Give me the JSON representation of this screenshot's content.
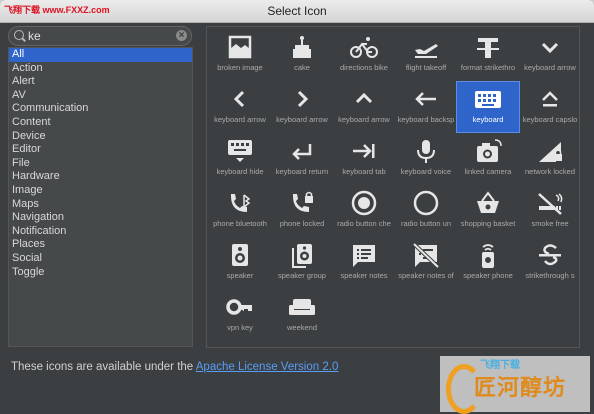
{
  "window": {
    "title": "Select Icon"
  },
  "watermark_top": "飞翔下载 www.FXXZ.com",
  "search": {
    "value": "ke"
  },
  "categories": [
    "All",
    "Action",
    "Alert",
    "AV",
    "Communication",
    "Content",
    "Device",
    "Editor",
    "File",
    "Hardware",
    "Image",
    "Maps",
    "Navigation",
    "Notification",
    "Places",
    "Social",
    "Toggle"
  ],
  "selected_category": "All",
  "icons": [
    {
      "label": "broken image",
      "icon": "broken-image-icon"
    },
    {
      "label": "cake",
      "icon": "cake-icon"
    },
    {
      "label": "directions bike",
      "icon": "bike-icon"
    },
    {
      "label": "flight takeoff",
      "icon": "flight-takeoff-icon"
    },
    {
      "label": "format strikethro",
      "icon": "strikethrough-icon"
    },
    {
      "label": "keyboard arrow",
      "icon": "arrow-down-icon"
    },
    {
      "label": "keyboard arrow",
      "icon": "arrow-left-icon"
    },
    {
      "label": "keyboard arrow",
      "icon": "arrow-right-icon"
    },
    {
      "label": "keyboard arrow",
      "icon": "arrow-up-icon"
    },
    {
      "label": "keyboard backsp",
      "icon": "backspace-icon"
    },
    {
      "label": "keyboard",
      "icon": "keyboard-icon"
    },
    {
      "label": "keyboard capslo",
      "icon": "capslock-icon"
    },
    {
      "label": "keyboard hide",
      "icon": "keyboard-hide-icon"
    },
    {
      "label": "keyboard return",
      "icon": "return-icon"
    },
    {
      "label": "keyboard tab",
      "icon": "tab-icon"
    },
    {
      "label": "keyboard voice",
      "icon": "mic-icon"
    },
    {
      "label": "linked camera",
      "icon": "linked-camera-icon"
    },
    {
      "label": "network locked",
      "icon": "network-locked-icon"
    },
    {
      "label": "phone bluetooth",
      "icon": "phone-bluetooth-icon"
    },
    {
      "label": "phone locked",
      "icon": "phone-locked-icon"
    },
    {
      "label": "radio button che",
      "icon": "radio-checked-icon"
    },
    {
      "label": "radio button un",
      "icon": "radio-unchecked-icon"
    },
    {
      "label": "shopping basket",
      "icon": "basket-icon"
    },
    {
      "label": "smoke free",
      "icon": "smoke-free-icon"
    },
    {
      "label": "speaker",
      "icon": "speaker-icon"
    },
    {
      "label": "speaker group",
      "icon": "speaker-group-icon"
    },
    {
      "label": "speaker notes",
      "icon": "speaker-notes-icon"
    },
    {
      "label": "speaker notes of",
      "icon": "speaker-notes-off-icon"
    },
    {
      "label": "speaker phone",
      "icon": "speaker-phone-icon"
    },
    {
      "label": "strikethrough s",
      "icon": "strikethrough-s-icon"
    },
    {
      "label": "vpn key",
      "icon": "vpn-key-icon"
    },
    {
      "label": "weekend",
      "icon": "weekend-icon"
    }
  ],
  "selected_icon": "keyboard",
  "footer": {
    "text": "These icons are available under the ",
    "link": "Apache License Version 2.0"
  },
  "logo": {
    "top": "飞翔下载",
    "text": "匠河醇坊"
  }
}
